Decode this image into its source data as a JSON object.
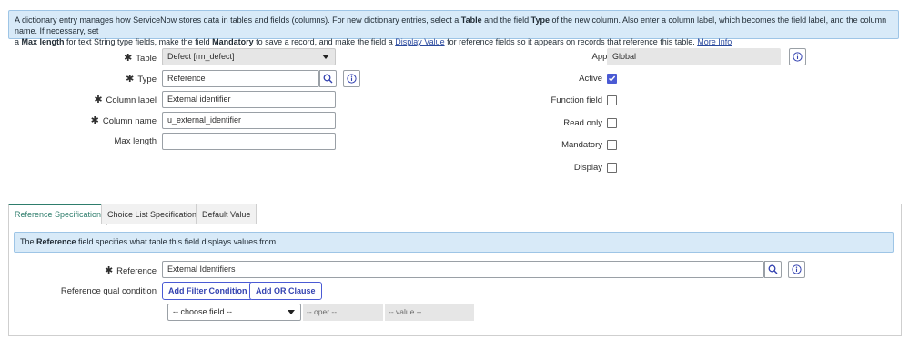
{
  "banner": {
    "t1": "A dictionary entry manages how ServiceNow stores data in tables and fields (columns). For new dictionary entries, select a ",
    "b1": "Table",
    "t2": " and the field ",
    "b2": "Type",
    "t3": " of the new column. Also enter a column label, which becomes the field label, and the column name. If necessary, set",
    "t4": "a ",
    "b3": "Max length",
    "t5": " for text String type fields, make the field ",
    "b4": "Mandatory",
    "t6": " to save a record, and make the field a ",
    "link1": "Display Value",
    "t7": " for reference fields so it appears on records that reference this table. ",
    "link2": "More Info"
  },
  "form": {
    "table": {
      "required_mark": "✱",
      "label": "Table",
      "value": "Defect [rm_defect]"
    },
    "type": {
      "required_mark": "✱",
      "label": "Type",
      "value": "Reference"
    },
    "column_label": {
      "required_mark": "✱",
      "label": "Column label",
      "value": "External identifier"
    },
    "column_name": {
      "required_mark": "✱",
      "label": "Column name",
      "value": "u_external_identifier"
    },
    "max_length": {
      "label": "Max length",
      "value": ""
    },
    "application": {
      "label": "Application",
      "value": "Global"
    },
    "active": {
      "label": "Active",
      "checked": true
    },
    "function_field": {
      "label": "Function field",
      "checked": false
    },
    "read_only": {
      "label": "Read only",
      "checked": false
    },
    "mandatory": {
      "label": "Mandatory",
      "checked": false
    },
    "display": {
      "label": "Display",
      "checked": false
    }
  },
  "tabs": [
    {
      "label": "Reference Specification",
      "active": true
    },
    {
      "label": "Choice List Specification",
      "active": false
    },
    {
      "label": "Default Value",
      "active": false
    }
  ],
  "reference_section": {
    "info": {
      "pre": "The ",
      "bold": "Reference",
      "post": " field specifies what table this field displays values from."
    },
    "reference": {
      "required_mark": "✱",
      "label": "Reference",
      "value": "External Identifiers"
    },
    "qual_label": "Reference qual condition",
    "add_filter": "Add Filter Condition",
    "add_or": "Add OR Clause",
    "choose_field": "-- choose field --",
    "oper": "-- oper --",
    "value": "-- value --"
  },
  "colors": {
    "accent": "#4a5ad4",
    "tab_active": "#2e7d6c",
    "banner_bg": "#d8eaf8"
  }
}
